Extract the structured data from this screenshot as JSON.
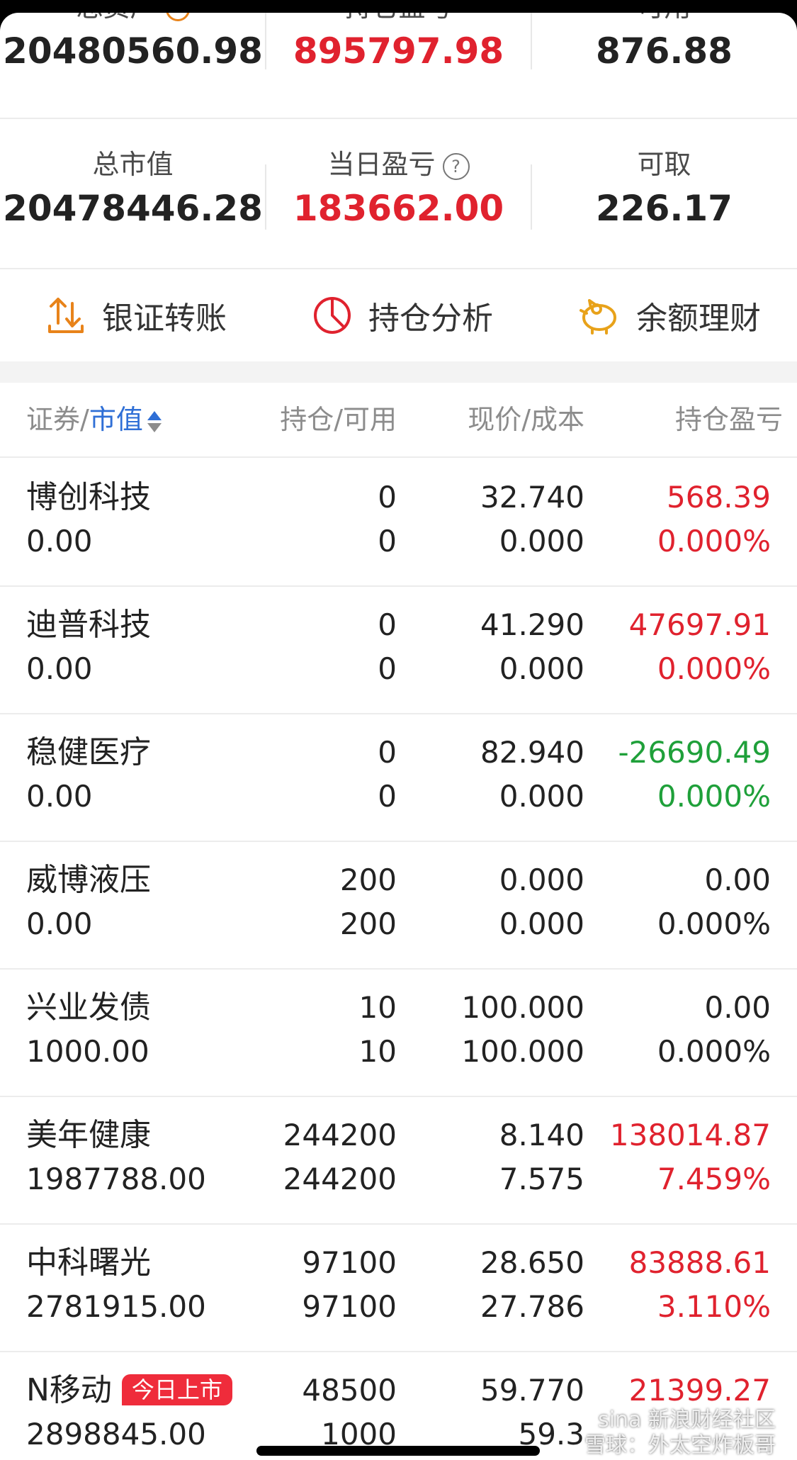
{
  "summary": {
    "row1": [
      {
        "label": "总资产",
        "value": "20480560.98"
      },
      {
        "label": "持仓盈亏",
        "value": "895797.98"
      },
      {
        "label": "可用",
        "value": "876.88"
      }
    ],
    "row2": [
      {
        "label": "总市值",
        "value": "20478446.28"
      },
      {
        "label": "当日盈亏",
        "value": "183662.00"
      },
      {
        "label": "可取",
        "value": "226.17"
      }
    ]
  },
  "actions": [
    {
      "label": "银证转账",
      "icon": "transfer-icon"
    },
    {
      "label": "持仓分析",
      "icon": "pie-chart-icon"
    },
    {
      "label": "余额理财",
      "icon": "piggy-bank-icon"
    }
  ],
  "table": {
    "headers": {
      "security": "证券",
      "slash1": "/",
      "market_value": "市值",
      "holding": "持仓/可用",
      "price": "现价/成本",
      "pnl": "持仓盈亏"
    },
    "rows": [
      {
        "name": "博创科技",
        "value": "0.00",
        "hold": "0",
        "avail": "0",
        "price": "32.740",
        "cost": "0.000",
        "pnl": "568.39",
        "pct": "0.000%",
        "color": "red"
      },
      {
        "name": "迪普科技",
        "value": "0.00",
        "hold": "0",
        "avail": "0",
        "price": "41.290",
        "cost": "0.000",
        "pnl": "47697.91",
        "pct": "0.000%",
        "color": "red"
      },
      {
        "name": "稳健医疗",
        "value": "0.00",
        "hold": "0",
        "avail": "0",
        "price": "82.940",
        "cost": "0.000",
        "pnl": "-26690.49",
        "pct": "0.000%",
        "color": "green"
      },
      {
        "name": "威博液压",
        "value": "0.00",
        "hold": "200",
        "avail": "200",
        "price": "0.000",
        "cost": "0.000",
        "pnl": "0.00",
        "pct": "0.000%",
        "color": "black"
      },
      {
        "name": "兴业发债",
        "value": "1000.00",
        "hold": "10",
        "avail": "10",
        "price": "100.000",
        "cost": "100.000",
        "pnl": "0.00",
        "pct": "0.000%",
        "color": "black"
      },
      {
        "name": "美年健康",
        "value": "1987788.00",
        "hold": "244200",
        "avail": "244200",
        "price": "8.140",
        "cost": "7.575",
        "pnl": "138014.87",
        "pct": "7.459%",
        "color": "red"
      },
      {
        "name": "中科曙光",
        "value": "2781915.00",
        "hold": "97100",
        "avail": "97100",
        "price": "28.650",
        "cost": "27.786",
        "pnl": "83888.61",
        "pct": "3.110%",
        "color": "red"
      },
      {
        "name": "N移动",
        "badge": "今日上市",
        "value": "2898845.00",
        "hold": "48500",
        "avail": "1000",
        "price": "59.770",
        "cost": "59.3",
        "pnl": "21399.27",
        "pct": "",
        "color": "red"
      }
    ]
  },
  "watermark": {
    "line1": "sina 新浪财经社区",
    "line2": "雪球：外太空炸板哥"
  },
  "colors": {
    "red": "#e0222e",
    "green": "#1fa03a",
    "blue": "#2f6fd6",
    "orange": "#e8831a"
  }
}
